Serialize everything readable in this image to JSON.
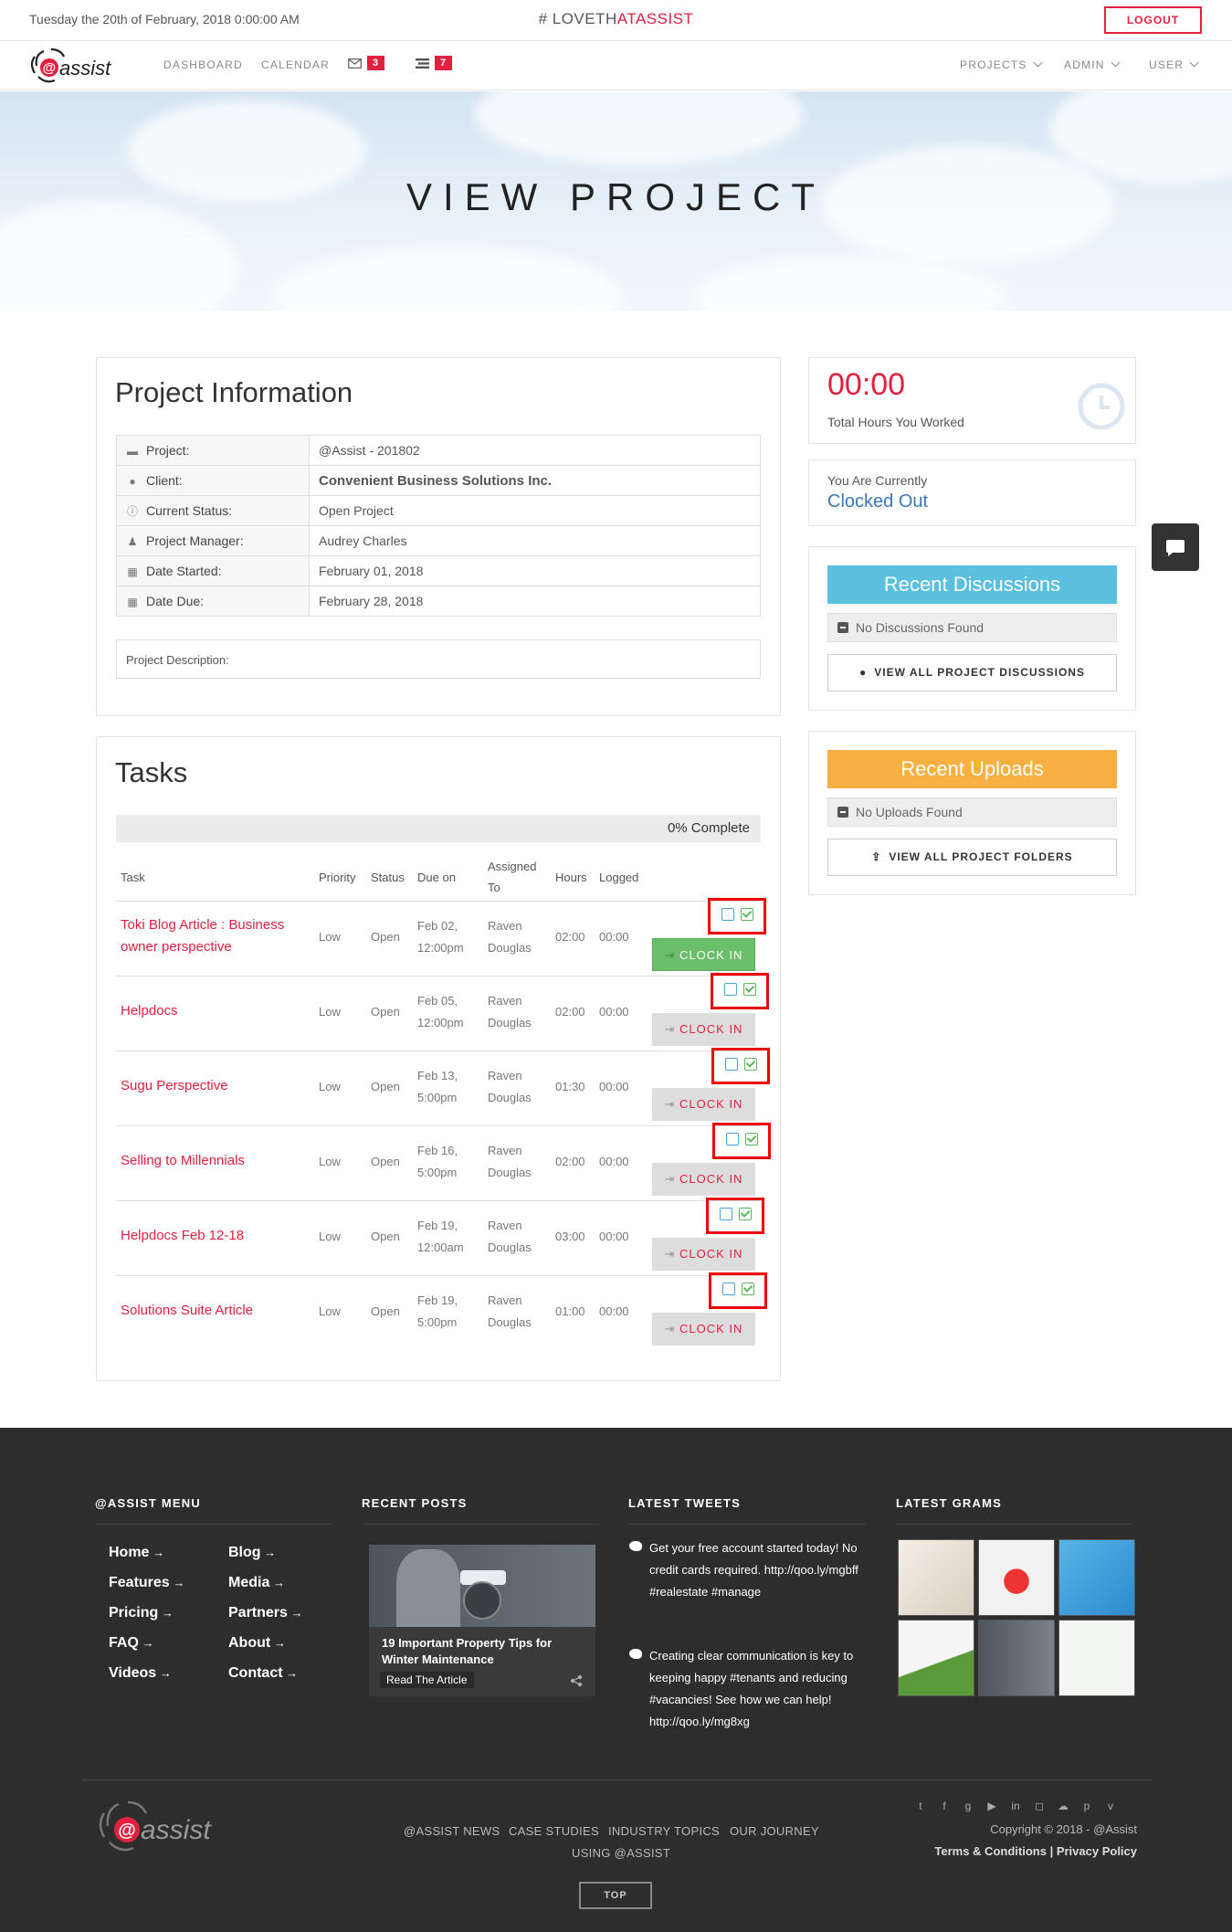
{
  "topbar": {
    "date": "Tuesday the 20th of February, 2018 0:00:00 AM",
    "hashtag_prefix": "# LOVETH",
    "hashtag_accent": "ATASSIST",
    "logout": "LOGOUT"
  },
  "nav": {
    "links": [
      "DASHBOARD",
      "CALENDAR"
    ],
    "mail_count": "3",
    "tasks_count": "7",
    "right": [
      "PROJECTS",
      "ADMIN",
      "USER"
    ]
  },
  "hero": {
    "title": "VIEW PROJECT"
  },
  "project_info": {
    "title": "Project Information",
    "rows": [
      {
        "label": "Project:",
        "value": "@Assist - 201802",
        "icon": "folder-icon"
      },
      {
        "label": "Client:",
        "value": "Convenient Business Solutions Inc.",
        "icon": "user-icon"
      },
      {
        "label": "Current Status:",
        "value": "Open Project",
        "icon": "info-icon"
      },
      {
        "label": "Project Manager:",
        "value": "Audrey Charles",
        "icon": "person-icon"
      },
      {
        "label": "Date Started:",
        "value": "February 01, 2018",
        "icon": "calendar-icon"
      },
      {
        "label": "Date Due:",
        "value": "February 28, 2018",
        "icon": "calendar-icon"
      }
    ],
    "description_label": "Project Description:"
  },
  "tasks": {
    "title": "Tasks",
    "progress": "0% Complete",
    "headers": {
      "task": "Task",
      "priority": "Priority",
      "status": "Status",
      "due": "Due on",
      "assigned": "Assigned To",
      "hours": "Hours",
      "logged": "Logged"
    },
    "clock_label": "CLOCK IN",
    "rows": [
      {
        "name": "Toki Blog Article : Business owner perspective",
        "priority": "Low",
        "status": "Open",
        "due": "Feb 02, 12:00pm",
        "assigned": "Raven Douglas",
        "hours": "02:00",
        "logged": "00:00",
        "active": true
      },
      {
        "name": "Helpdocs",
        "priority": "Low",
        "status": "Open",
        "due": "Feb 05, 12:00pm",
        "assigned": "Raven Douglas",
        "hours": "02:00",
        "logged": "00:00",
        "active": false
      },
      {
        "name": "Sugu Perspective",
        "priority": "Low",
        "status": "Open",
        "due": "Feb 13, 5:00pm",
        "assigned": "Raven Douglas",
        "hours": "01:30",
        "logged": "00:00",
        "active": false
      },
      {
        "name": "Selling to Millennials",
        "priority": "Low",
        "status": "Open",
        "due": "Feb 16, 5:00pm",
        "assigned": "Raven Douglas",
        "hours": "02:00",
        "logged": "00:00",
        "active": false
      },
      {
        "name": "Helpdocs Feb 12-18",
        "priority": "Low",
        "status": "Open",
        "due": "Feb 19, 12:00am",
        "assigned": "Raven Douglas",
        "hours": "03:00",
        "logged": "00:00",
        "active": false
      },
      {
        "name": "Solutions Suite Article",
        "priority": "Low",
        "status": "Open",
        "due": "Feb 19, 5:00pm",
        "assigned": "Raven Douglas",
        "hours": "01:00",
        "logged": "00:00",
        "active": false
      }
    ]
  },
  "sidebar": {
    "hours": "00:00",
    "hours_label": "Total Hours You Worked",
    "currently_label": "You Are Currently",
    "currently_value": "Clocked Out",
    "discussions_title": "Recent Discussions",
    "discussions_empty": "No Discussions Found",
    "discussions_button": "VIEW ALL PROJECT DISCUSSIONS",
    "uploads_title": "Recent Uploads",
    "uploads_empty": "No Uploads Found",
    "uploads_button": "VIEW ALL PROJECT FOLDERS"
  },
  "footer": {
    "menu_title": "@ASSIST MENU",
    "menu_col1": [
      "Home",
      "Features",
      "Pricing",
      "FAQ",
      "Videos"
    ],
    "menu_col2": [
      "Blog",
      "Media",
      "Partners",
      "About",
      "Contact"
    ],
    "posts_title": "RECENT POSTS",
    "post_title": "19 Important Property Tips for Winter Maintenance",
    "post_button": "Read The Article",
    "tweets_title": "LATEST TWEETS",
    "tweet1": "Get your free account started today! No credit cards required. http://qoo.ly/mgbff #realestate #manage",
    "tweet2": "Creating clear communication is key to keeping happy #tenants and reducing #vacancies! See how we can help! http://qoo.ly/mg8xg",
    "grams_title": "LATEST GRAMS",
    "bottom_links": [
      "@ASSIST NEWS",
      "CASE STUDIES",
      "INDUSTRY TOPICS",
      "OUR JOURNEY",
      "USING @ASSIST"
    ],
    "top_button": "TOP",
    "copyright": "Copyright © 2018 - @Assist",
    "terms": "Terms & Conditions",
    "sep": "|",
    "privacy": "Privacy Policy"
  },
  "colors": {
    "accent": "#e3203f",
    "discussions": "#5bc0de",
    "uploads": "#f7b041",
    "footer": "#2d2d2d"
  }
}
